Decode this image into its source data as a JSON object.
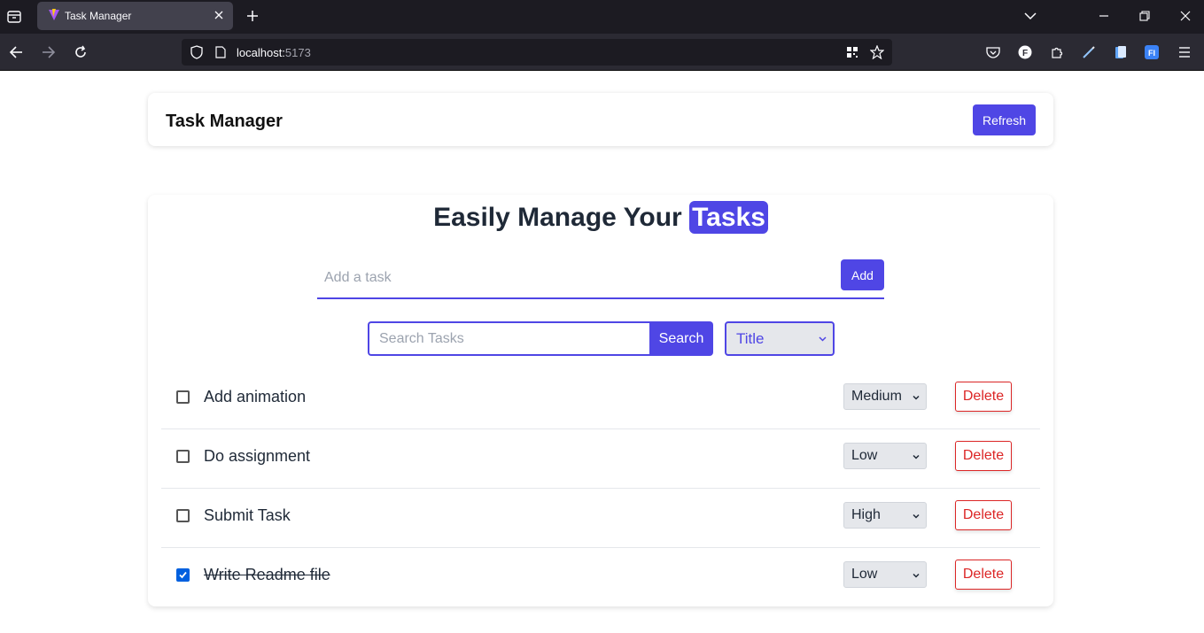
{
  "browser": {
    "tab_title": "Task Manager",
    "url_host": "localhost:",
    "url_port": "5173"
  },
  "app": {
    "title": "Task Manager",
    "refresh_label": "Refresh",
    "hero_prefix": "Easily Manage Your",
    "hero_highlight": "Tasks",
    "add_placeholder": "Add a task",
    "add_label": "Add",
    "search_placeholder": "Search Tasks",
    "search_label": "Search",
    "sort_value": "Title",
    "delete_label": "Delete"
  },
  "tasks": [
    {
      "title": "Add animation",
      "priority": "Medium",
      "done": false
    },
    {
      "title": "Do assignment",
      "priority": "Low",
      "done": false
    },
    {
      "title": "Submit Task",
      "priority": "High",
      "done": false
    },
    {
      "title": "Write Readme file",
      "priority": "Low",
      "done": true
    }
  ],
  "colors": {
    "accent": "#4f46e5",
    "danger": "#dc2626",
    "checked": "#0060df"
  }
}
